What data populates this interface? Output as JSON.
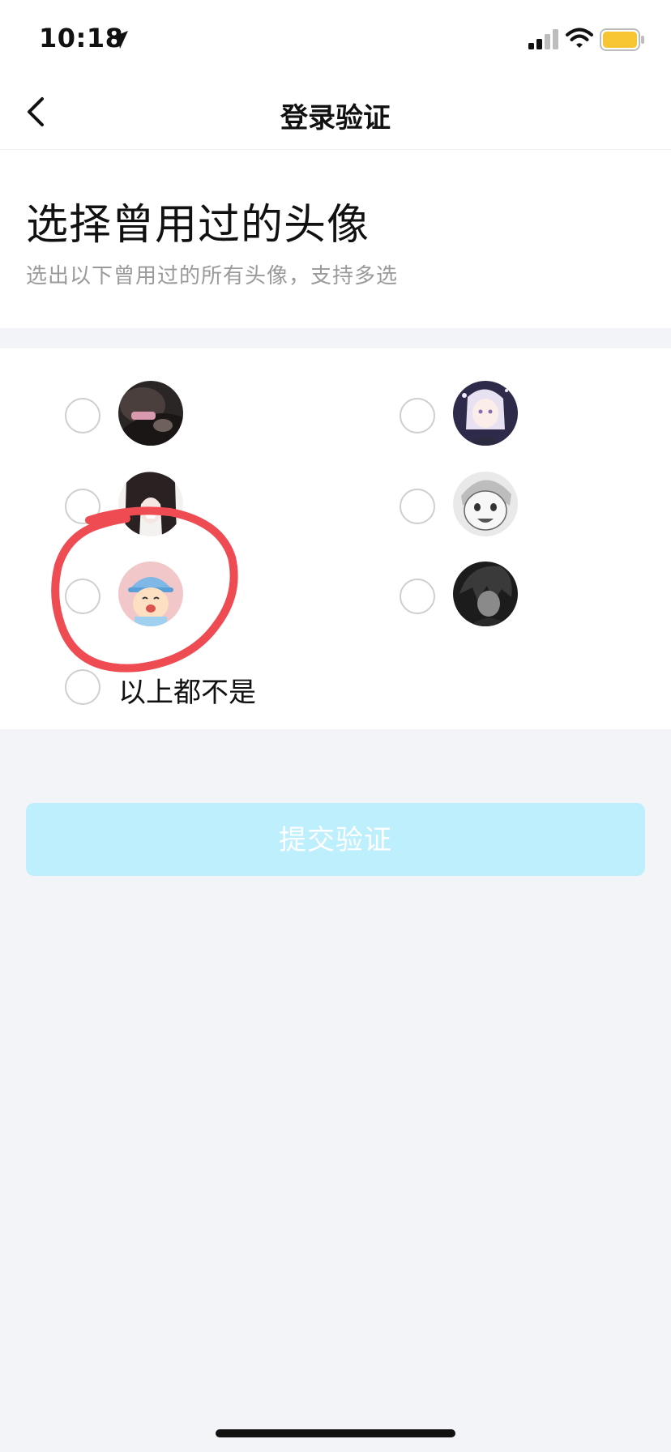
{
  "status_bar": {
    "time": "10:18",
    "battery_color": "#f7c531",
    "icons": [
      "location-arrow-icon",
      "signal-bars-icon",
      "wifi-icon",
      "battery-icon"
    ]
  },
  "nav": {
    "title": "登录验证",
    "back_icon": "chevron-left-icon"
  },
  "heading": {
    "title": "选择曾用过的头像",
    "subtitle": "选出以下曾用过的所有头像，支持多选"
  },
  "options": {
    "avatars": [
      {
        "name": "avatar-dark-photo",
        "selected": false
      },
      {
        "name": "avatar-anime-girl-lavender",
        "selected": false
      },
      {
        "name": "avatar-dark-hair",
        "selected": false
      },
      {
        "name": "avatar-sketch-face",
        "selected": false
      },
      {
        "name": "avatar-cartoon-helmet",
        "selected": false
      },
      {
        "name": "avatar-dark-anime-boy",
        "selected": false
      }
    ],
    "none_label": "以上都不是",
    "none_selected": false
  },
  "submit": {
    "label": "提交验证",
    "enabled": false,
    "color": "#bdeffc"
  },
  "colors": {
    "background": "#f3f4f7",
    "annotation_red": "#ee4b52"
  }
}
